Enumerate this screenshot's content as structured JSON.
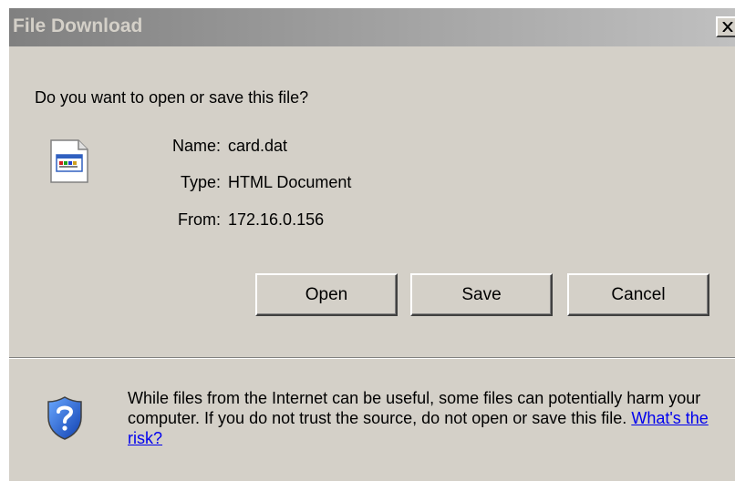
{
  "window": {
    "title": "File Download",
    "close_glyph": "X"
  },
  "prompt": {
    "question": "Do you want to open or save this file?"
  },
  "file": {
    "icon": "html-document-icon",
    "fields": [
      {
        "label": "Name:",
        "value": "card.dat"
      },
      {
        "label": "Type:",
        "value": "HTML Document"
      },
      {
        "label": "From:",
        "value": "172.16.0.156"
      }
    ]
  },
  "buttons": {
    "open": "Open",
    "save": "Save",
    "cancel": "Cancel"
  },
  "warning": {
    "icon": "shield-question-icon",
    "text": "While files from the Internet can be useful, some files can potentially harm your computer. If you do not trust the source, do not open or save this file.",
    "link": "What's the risk?"
  },
  "colors": {
    "dialog_bg": "#d4d0c8",
    "titlebar_start": "#808080",
    "titlebar_end": "#c0c0c0",
    "link": "#0000ee"
  }
}
